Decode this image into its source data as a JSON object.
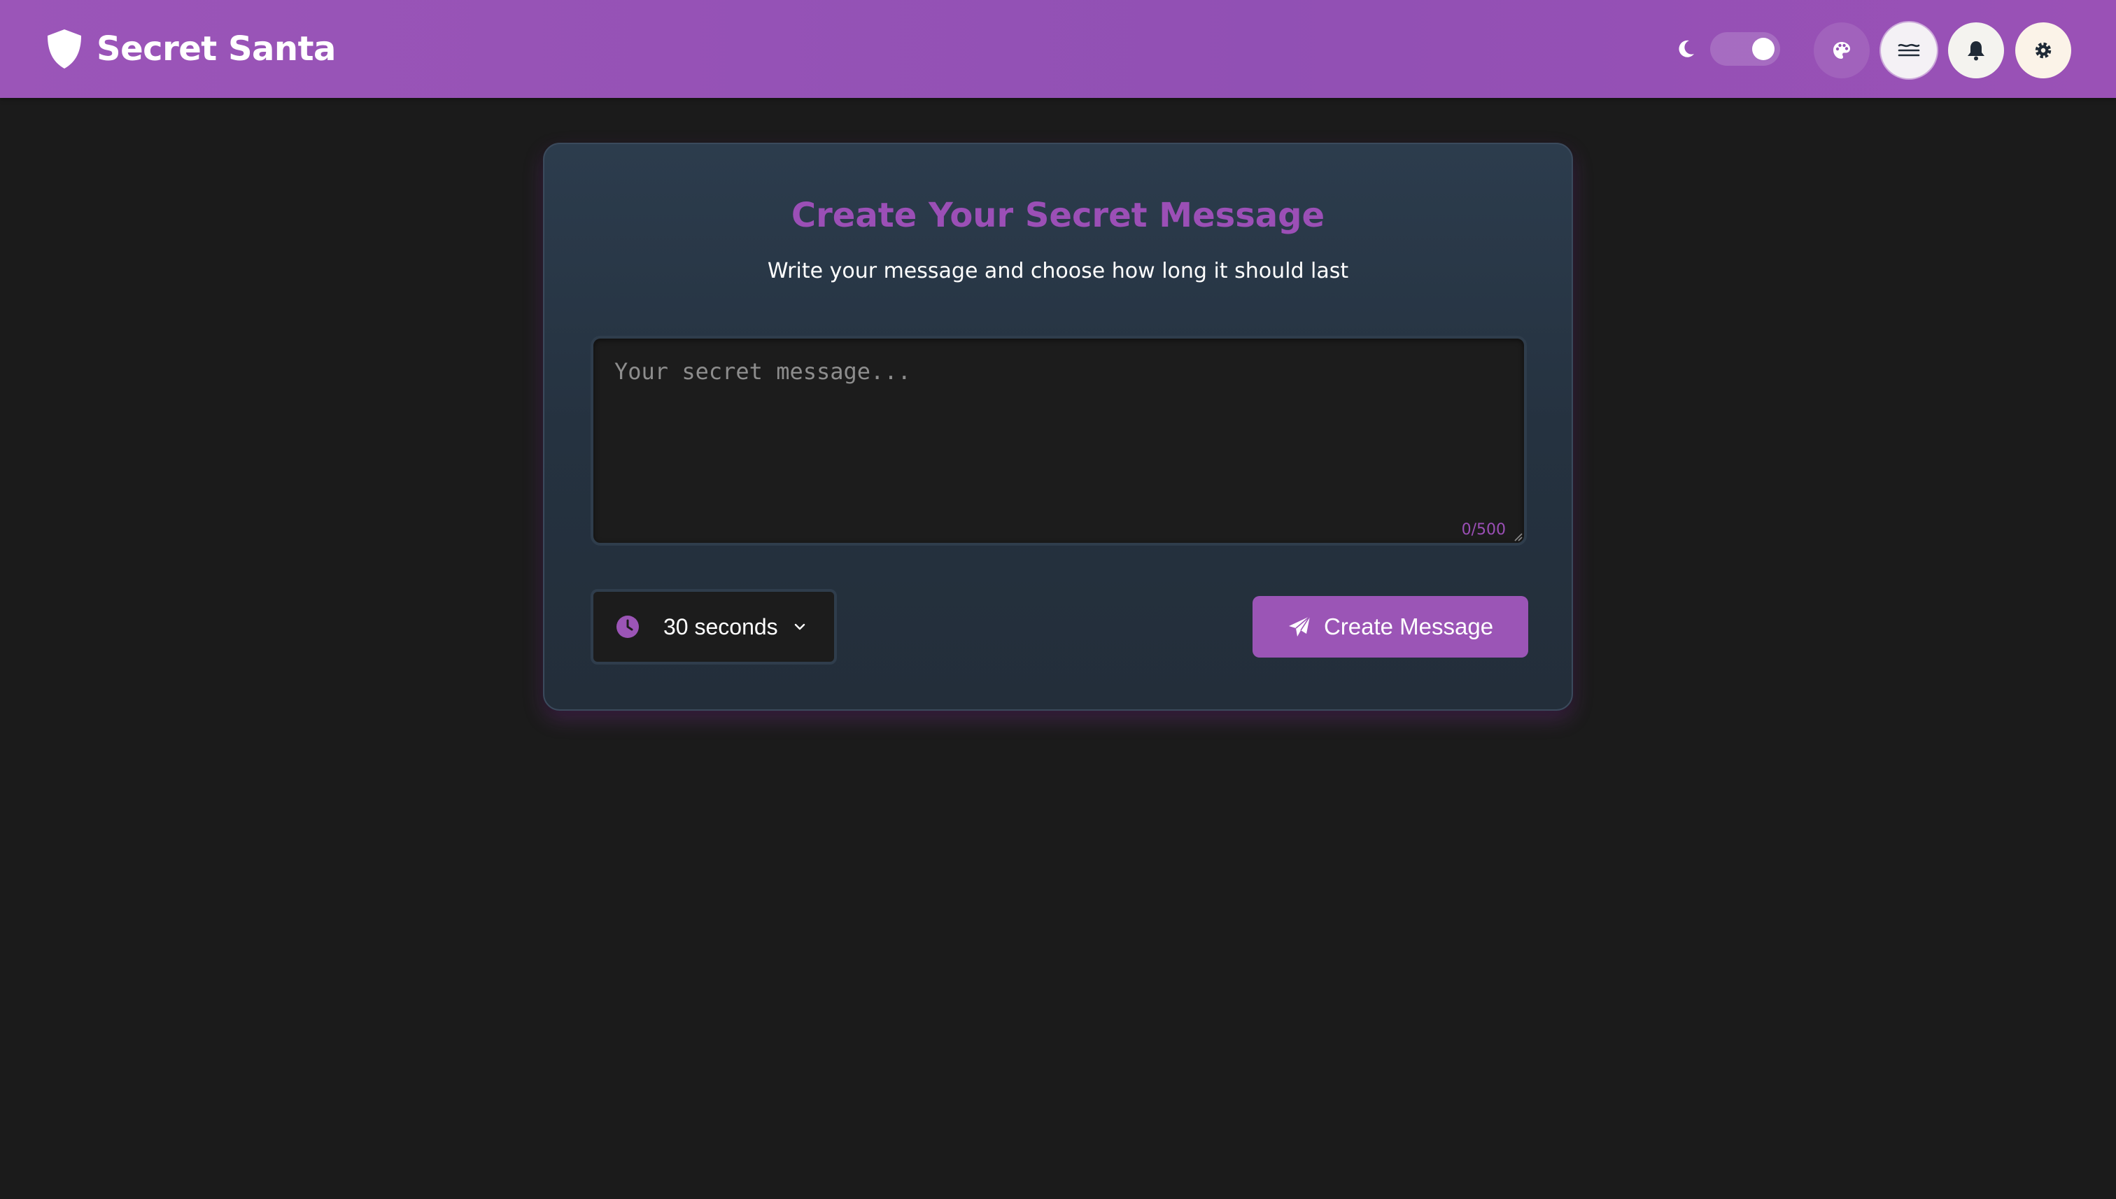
{
  "app": {
    "title": "Secret Santa",
    "logo_icon": "shield-icon"
  },
  "header": {
    "theme_mode": "dark",
    "toggle_on": true,
    "icons": [
      "moon-icon",
      "palette-icon",
      "layers-icon",
      "bell-icon",
      "gear-icon"
    ]
  },
  "card": {
    "title": "Create Your Secret Message",
    "subtitle": "Write your message and choose how long it should last",
    "message": {
      "value": "",
      "placeholder": "Your secret message...",
      "count": "0/500"
    },
    "timer": {
      "selected": "30 seconds",
      "icon": "clock-icon"
    },
    "create_button": {
      "label": "Create Message",
      "icon": "paper-plane-icon"
    }
  },
  "colors": {
    "accent": "#9b55b6",
    "header_bg": "#9451b5",
    "page_bg": "#1b1b1b",
    "card_bg": "#283645"
  }
}
